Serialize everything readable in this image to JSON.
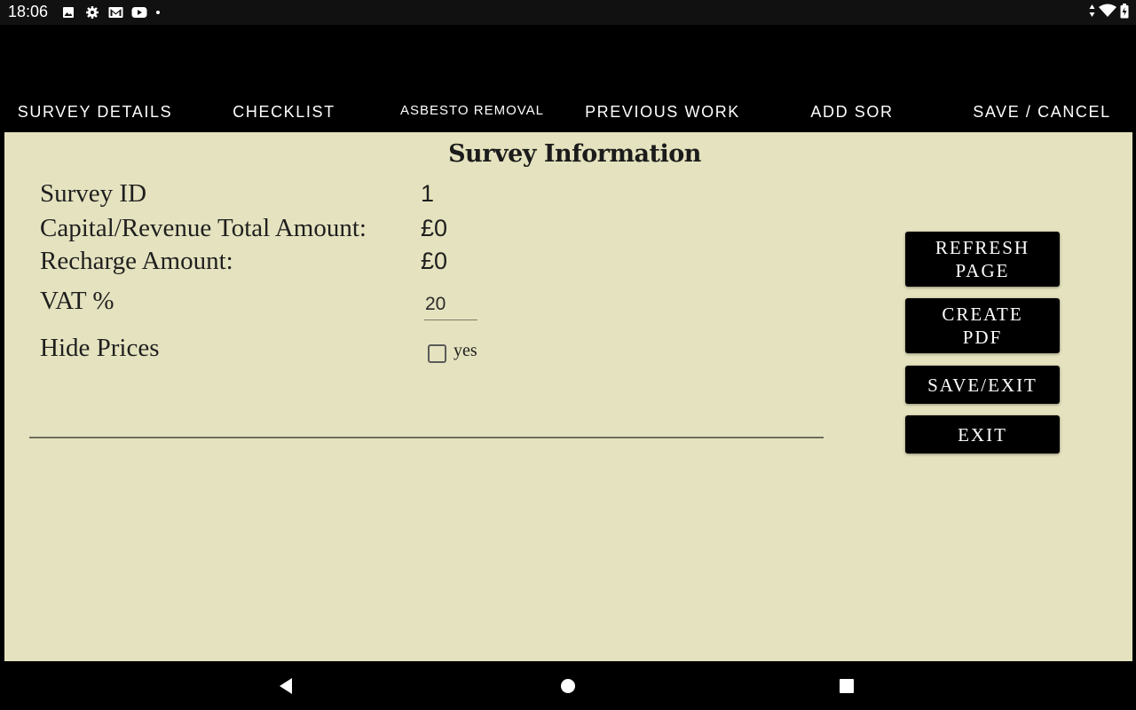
{
  "status_bar": {
    "time": "18:06",
    "left_icons": [
      "image-icon",
      "gear-icon",
      "gmail-icon",
      "youtube-icon",
      "dot-icon"
    ],
    "right_icons": [
      "data-arrows-icon",
      "wifi-icon",
      "battery-icon"
    ]
  },
  "tabs": [
    {
      "label": "SURVEY DETAILS"
    },
    {
      "label": "CHECKLIST"
    },
    {
      "label": "ASBESTO REMOVAL"
    },
    {
      "label": "PREVIOUS WORK"
    },
    {
      "label": "ADD SOR"
    },
    {
      "label": "SAVE / CANCEL"
    }
  ],
  "content": {
    "title": "Survey Information",
    "survey_id": {
      "label": "Survey ID",
      "value": "1"
    },
    "capital_revenue": {
      "label": "Capital/Revenue Total Amount:",
      "value": "£0"
    },
    "recharge": {
      "label": "Recharge Amount:",
      "value": "£0"
    },
    "vat": {
      "label": "VAT %",
      "value": "20"
    },
    "hide_prices": {
      "label": "Hide Prices",
      "checkbox_label": "yes",
      "checked": false
    }
  },
  "buttons": {
    "refresh": "REFRESH\nPAGE",
    "create_pdf": "CREATE\nPDF",
    "save_exit": "SAVE/EXIT",
    "exit": "EXIT"
  },
  "colors": {
    "content_bg": "#e5e3bf",
    "bar_bg": "#000000",
    "button_bg": "#000000"
  },
  "nav_bar": {
    "icons": [
      "back-icon",
      "home-icon",
      "recents-icon"
    ]
  }
}
